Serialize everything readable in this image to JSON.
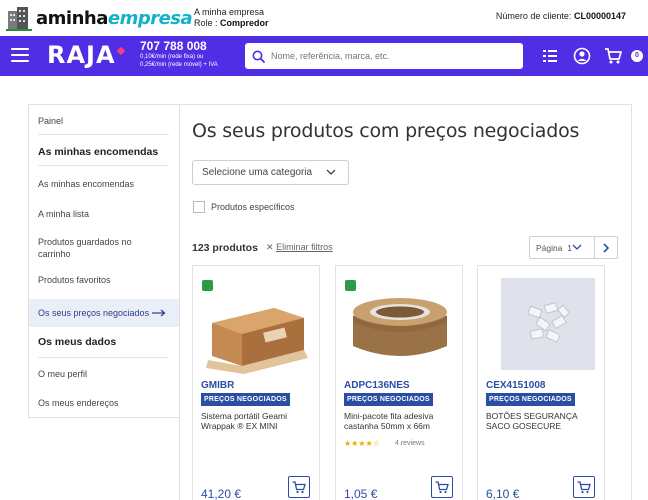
{
  "topbar": {
    "logo_part1": "aminha",
    "logo_part2": "empresa",
    "company_line": "A minha empresa",
    "role_label": "Role :",
    "role_value": "Compredor",
    "client_label": "Número de cliente:",
    "client_number": "CL00000147"
  },
  "header": {
    "brand": "RAJA",
    "phone_number": "707 788 008",
    "phone_rate_fixed": "0,10€/min (rede fixa) ou",
    "phone_rate_mobile": "0,25€/min (rede móvel) + IVA",
    "search_placeholder": "Nome, referência, marca, etc.",
    "cart_count": "0",
    "accent_color": "#4f2ee6"
  },
  "sidebar": {
    "dashboard": "Painel",
    "orders_section": "As minhas encomendas",
    "items": [
      "As minhas encomendas",
      "A minha lista",
      "Produtos guardados no carrinho",
      "Produtos favoritos",
      "Os seus preços negociados"
    ],
    "data_section": "Os meus dados",
    "data_items": [
      "O meu perfil",
      "Os meus endereços"
    ]
  },
  "main": {
    "title": "Os seus produtos com preços negociados",
    "category_select": "Selecione uma categoria",
    "specific_products": "Produtos específicos",
    "product_count": "123 produtos",
    "clear_filters": "Eliminar filtros",
    "page_label": "Página",
    "page_number": "1"
  },
  "products": [
    {
      "ref": "GMIBR",
      "tag": "PREÇOS NEGOCIADOS",
      "name": "Sistema portátil Geami Wrappak ® EX MINI",
      "price": "41,20 €",
      "eco": true
    },
    {
      "ref": "ADPC136NES",
      "tag": "PREÇOS NEGOCIADOS",
      "name": "Mini-pacote fita adesiva castanha 50mm x 66m",
      "rating": 4,
      "stars": "★★★★☆",
      "reviews": "4 reviews",
      "price": "1,05 €",
      "eco": true
    },
    {
      "ref": "CEX4151008",
      "tag": "PREÇOS NEGOCIADOS",
      "name": "BOTÕES SEGURANÇA SACO GOSECURE",
      "price": "6,10 €",
      "eco": false
    }
  ]
}
